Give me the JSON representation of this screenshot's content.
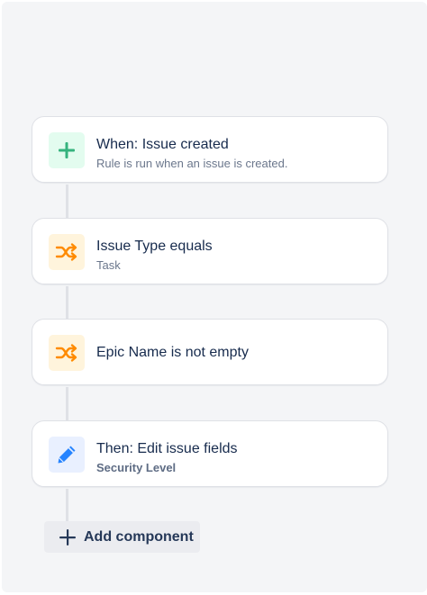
{
  "rules": [
    {
      "title": "When: Issue created",
      "subtitle": "Rule is run when an issue is created.",
      "icon": "plus-icon",
      "color": "#36b37e",
      "background": "#e3fcef"
    },
    {
      "title": "Issue Type equals",
      "subtitle": "Task",
      "icon": "shuffle-icon",
      "color": "#ff8b00",
      "background": "#fff4dc"
    },
    {
      "title": "Epic Name is not empty",
      "icon": "shuffle-icon",
      "color": "#ff8b00",
      "background": "#fff4dc"
    },
    {
      "title": "Then: Edit issue fields",
      "subtitle": "Security Level",
      "icon": "pencil-icon",
      "color": "#2684ff",
      "background": "#e9f0ff"
    }
  ],
  "add_button": {
    "label": "Add component",
    "icon": "plus-icon"
  }
}
